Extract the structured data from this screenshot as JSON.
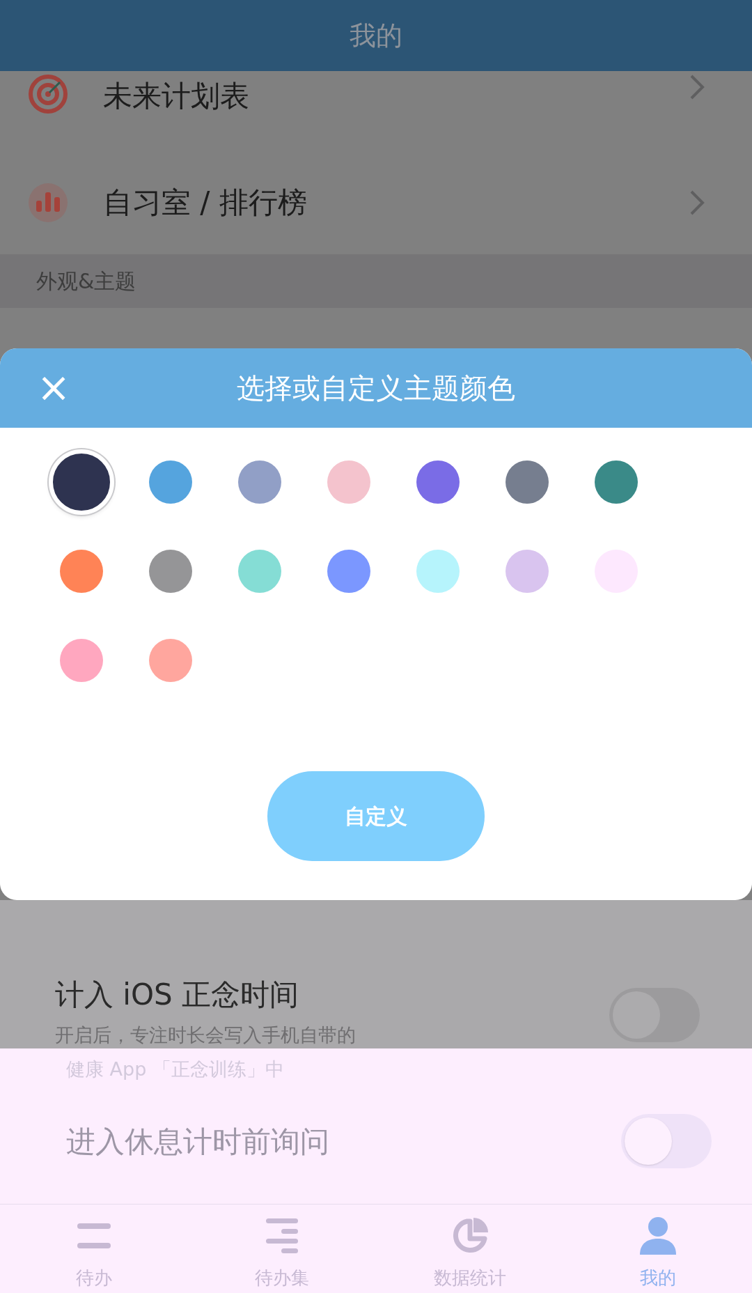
{
  "header": {
    "title": "我的"
  },
  "menu_items": [
    {
      "label": "未来计划表",
      "kind": "target"
    },
    {
      "label": "自习室 / 排行榜",
      "kind": "bars"
    }
  ],
  "section_header": "外观&主题",
  "theme_dialog": {
    "title": "选择或自定义主题颜色",
    "close": "×",
    "colors": [
      {
        "color": "#2e3350",
        "selected": true
      },
      {
        "color": "#55a4de",
        "selected": false
      },
      {
        "color": "#919fc6",
        "selected": false
      },
      {
        "color": "#f4c3cd",
        "selected": false
      },
      {
        "color": "#7a6ce6",
        "selected": false
      },
      {
        "color": "#767e8f",
        "selected": false
      },
      {
        "color": "#3a8a88",
        "selected": false
      },
      {
        "color": "#ff8356",
        "selected": false
      },
      {
        "color": "#959597",
        "selected": false
      },
      {
        "color": "#85ddd5",
        "selected": false
      },
      {
        "color": "#7b97ff",
        "selected": false
      },
      {
        "color": "#b6f4fc",
        "selected": false
      },
      {
        "color": "#d9c4ef",
        "selected": false
      },
      {
        "color": "#fde8fe",
        "selected": false
      },
      {
        "color": "#ffa7bf",
        "selected": false
      },
      {
        "color": "#ffa69e",
        "selected": false
      }
    ],
    "custom_button": "自定义"
  },
  "settings": [
    {
      "label": "计入 iOS 正念时间",
      "description": [
        "开启后，专注时长会写入手机自带的",
        "健康 App 「正念训练」中"
      ],
      "on": false
    },
    {
      "label": "进入休息计时前询问",
      "on": false
    }
  ],
  "tab_bar": [
    {
      "label": "待办",
      "kind": "list",
      "selected": false
    },
    {
      "label": "待办集",
      "kind": "stack",
      "selected": false
    },
    {
      "label": "数据统计",
      "kind": "pie",
      "selected": false
    },
    {
      "label": "我的",
      "kind": "person",
      "selected": true
    }
  ]
}
